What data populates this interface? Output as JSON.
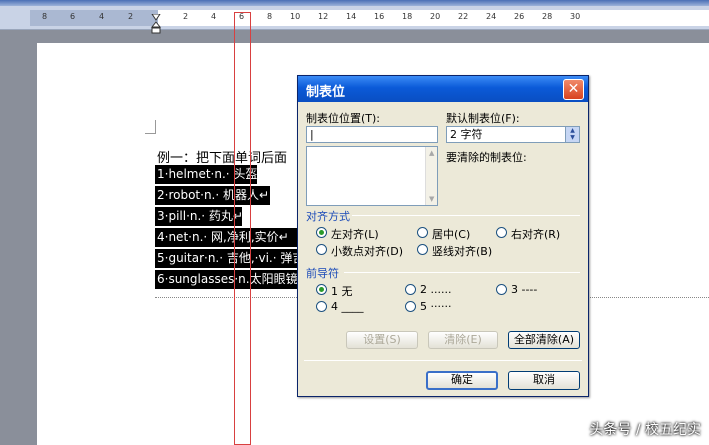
{
  "ruler": {
    "left_numbers": [
      "8",
      "6",
      "4",
      "2"
    ],
    "right_numbers": [
      "2",
      "4",
      "6",
      "8",
      "10",
      "12",
      "14",
      "16",
      "18",
      "20",
      "22",
      "24",
      "26",
      "28",
      "30"
    ]
  },
  "document": {
    "intro": "例一：把下面单词后面",
    "lines": [
      "1·helmet·n.· 头盔↵",
      "2·robot·n.· 机器人↵",
      "3·pill·n.· 药丸↵",
      "4·net·n.· 网,净利,实价↵",
      "5·guitar·n.· 吉他,·vi.· 弹吉",
      "6·sunglasses·n.太阳眼镜"
    ]
  },
  "dialog": {
    "title": "制表位",
    "close_label": "✕",
    "tab_position_label": "制表位位置(T):",
    "tab_position_value": "|",
    "default_tab_label": "默认制表位(F):",
    "default_tab_value": "2 字符",
    "clear_label": "要清除的制表位:",
    "alignment_section": "对齐方式",
    "alignment_options": [
      "左对齐(L)",
      "居中(C)",
      "右对齐(R)",
      "小数点对齐(D)",
      "竖线对齐(B)"
    ],
    "alignment_selected": "左对齐(L)",
    "leader_section": "前导符",
    "leader_options": [
      "1 无",
      "2 ......",
      "3 ----",
      "4 ____",
      "5 ······"
    ],
    "leader_selected": "1 无",
    "set_button": "设置(S)",
    "clear_button": "清除(E)",
    "clear_all_button": "全部清除(A)",
    "ok_button": "确定",
    "cancel_button": "取消"
  },
  "watermark": "头条号 / 校五纪实"
}
